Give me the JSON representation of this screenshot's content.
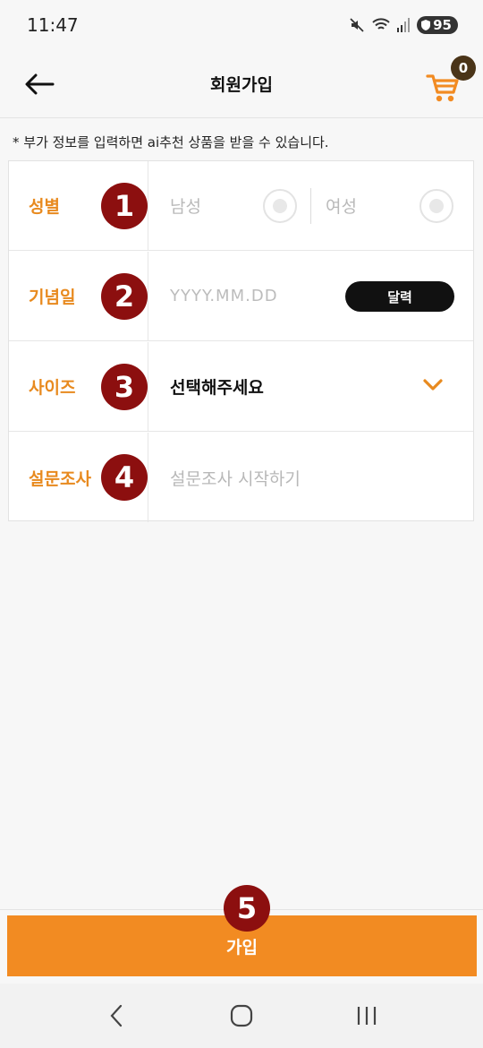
{
  "status_bar": {
    "time": "11:47",
    "battery": "95"
  },
  "header": {
    "title": "회원가입",
    "cart_count": "0"
  },
  "notice": "* 부가 정보를 입력하면 ai추천 상품을 받을 수 있습니다.",
  "form": {
    "gender": {
      "label": "성별",
      "badge": "1",
      "male": "남성",
      "female": "여성"
    },
    "anniversary": {
      "label": "기념일",
      "badge": "2",
      "placeholder": "YYYY.MM.DD",
      "calendar_button": "달력"
    },
    "size": {
      "label": "사이즈",
      "badge": "3",
      "value": "선택해주세요"
    },
    "survey": {
      "label": "설문조사",
      "badge": "4",
      "placeholder": "설문조사 시작하기"
    }
  },
  "submit": {
    "label": "가입",
    "badge": "5"
  },
  "colors": {
    "accent": "#f28b22",
    "label_orange": "#e88a1f",
    "badge_red": "#8c0f0f"
  },
  "icons": [
    "back-arrow-icon",
    "cart-icon",
    "chevron-down-icon",
    "nav-back-icon",
    "nav-home-icon",
    "nav-recents-icon"
  ]
}
